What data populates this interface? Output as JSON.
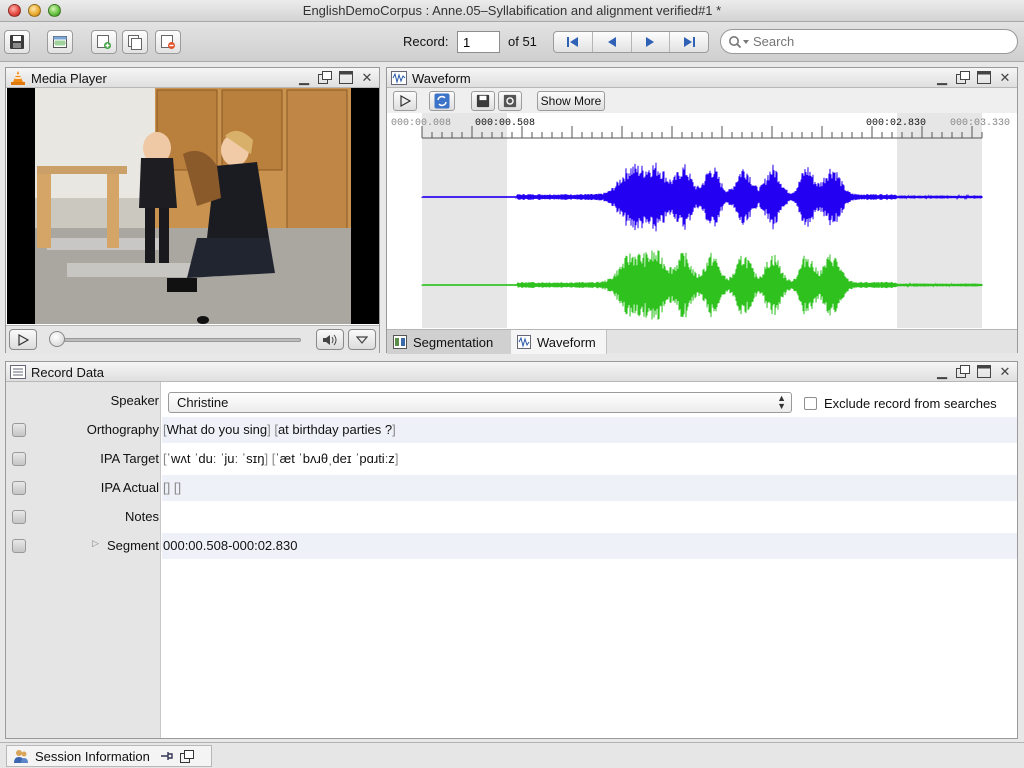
{
  "window": {
    "title": "EnglishDemoCorpus : Anne.05–Syllabification and alignment verified#1 *"
  },
  "toolbar": {
    "record_label": "Record:",
    "record_value": "1",
    "record_of": "of 51",
    "search_placeholder": "Search"
  },
  "media_player": {
    "title": "Media Player"
  },
  "waveform": {
    "title": "Waveform",
    "show_more_label": "Show More",
    "time_labels": {
      "start": "000:00.008",
      "seg_start": "000:00.508",
      "seg_end": "000:02.830",
      "end": "000:03.330"
    },
    "channel_colors": [
      "#2400f2",
      "#2fc21f"
    ],
    "tabs": [
      "Segmentation",
      "Waveform"
    ]
  },
  "record_data": {
    "title": "Record Data",
    "speaker_label": "Speaker",
    "speaker_value": "Christine",
    "exclude_label": "Exclude record from searches",
    "rows": [
      {
        "label": "Orthography",
        "groups": [
          "What do you sing",
          "at birthday parties ?"
        ]
      },
      {
        "label": "IPA Target",
        "groups": [
          "ˈwʌt ˈduː ˈjuː ˈsɪŋ",
          "ˈæt ˈbʌɹθˌdeɪ ˈpɑɹtiːz"
        ]
      },
      {
        "label": "IPA Actual",
        "groups": [
          "",
          ""
        ]
      },
      {
        "label": "Notes",
        "value": ""
      },
      {
        "label": "Segment",
        "value": "000:00.508-000:02.830"
      }
    ]
  },
  "status": {
    "session_tab": "Session Information"
  }
}
